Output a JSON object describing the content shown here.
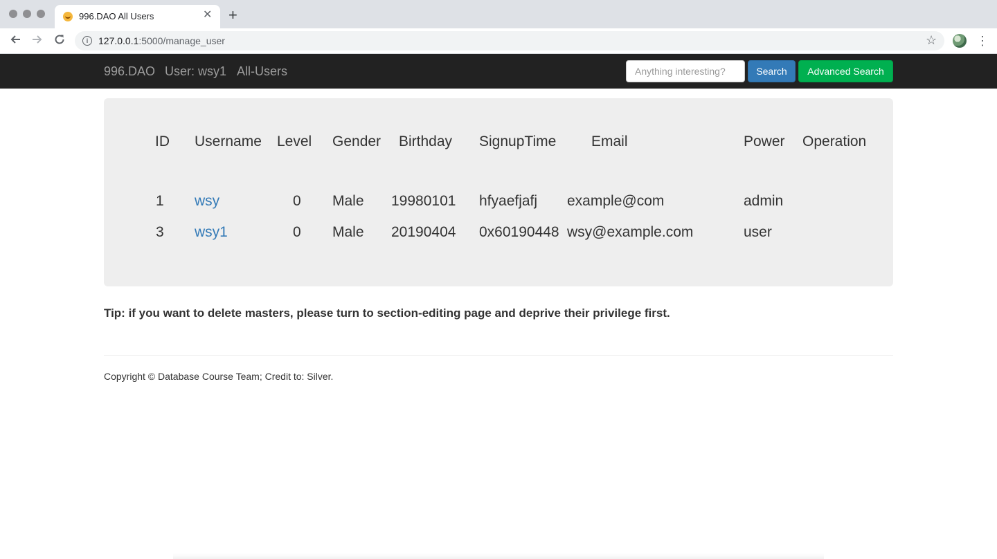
{
  "browser": {
    "tab_title": "996.DAO All Users",
    "new_tab_symbol": "+",
    "url_host": "127.0.0.1",
    "url_rest": ":5000/manage_user"
  },
  "navbar": {
    "brand": "996.DAO",
    "user_label": "User: wsy1",
    "all_users": "All-Users",
    "search_placeholder": "Anything interesting?",
    "search_button": "Search",
    "advanced_search_button": "Advanced Search"
  },
  "table": {
    "headers": [
      "ID",
      "Username",
      "Level",
      "Gender",
      "Birthday",
      "SignupTime",
      "Email",
      "Power",
      "Operation"
    ],
    "rows": [
      {
        "id": "1",
        "username": "wsy",
        "level": "0",
        "gender": "Male",
        "birthday": "19980101",
        "signup": "hfyaefjafj",
        "email": "example@com",
        "power": "admin",
        "operation": ""
      },
      {
        "id": "3",
        "username": "wsy1",
        "level": "0",
        "gender": "Male",
        "birthday": "20190404",
        "signup": "0x60190448",
        "email": "wsy@example.com",
        "power": "user",
        "operation": ""
      }
    ]
  },
  "tip": "Tip: if you want to delete masters, please turn to section-editing page and deprive their privilege first.",
  "footer": "Copyright © Database Course Team; Credit to: Silver.",
  "colors": {
    "navbar_bg": "#222222",
    "search_button": "#337ab7",
    "advanced_search_button": "#00b050",
    "link": "#337ab7",
    "panel_bg": "#eeeeee"
  },
  "icons": [
    "back-arrow-icon",
    "forward-arrow-icon",
    "reload-icon",
    "info-icon",
    "star-icon",
    "profile-avatar",
    "kebab-menu-icon",
    "tab-close-icon",
    "favicon"
  ]
}
